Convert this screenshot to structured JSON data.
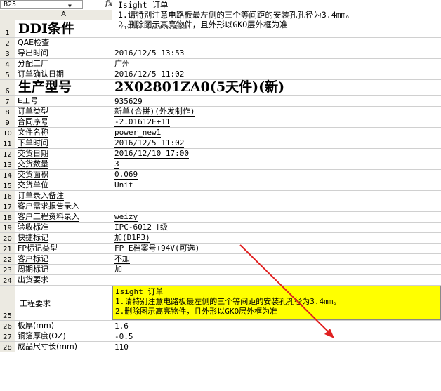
{
  "formula_bar": {
    "name_box": "B25",
    "fx_label": "fx",
    "lines": [
      "Isight 订单",
      "1.请特别注意电路板最左侧的三个等间距的安装孔孔径为3.4mm。",
      "2.删除图示高亮物件，且外形以GKO层外框为准"
    ]
  },
  "columns": {
    "a": "A"
  },
  "overflow_text": "（以光之DDI流程）",
  "rows": [
    {
      "num": "1",
      "a": "DDI条件",
      "b": "",
      "style": "big"
    },
    {
      "num": "2",
      "a": "QAE检查",
      "b": ""
    },
    {
      "num": "3",
      "a": "导出时间",
      "b": "2016/12/5 13:53"
    },
    {
      "num": "4",
      "a": "分配工厂",
      "b": "广州"
    },
    {
      "num": "5",
      "a": "订单确认日期",
      "b": "2016/12/5 11:02"
    },
    {
      "num": "6",
      "a": "生产型号",
      "b": "2X02801ZA0(5天件)(新)",
      "style": "big"
    },
    {
      "num": "7",
      "a": "E工号",
      "b": "935629"
    },
    {
      "num": "8",
      "a": "订单类型",
      "b": "新单(合拼)(外发制作)"
    },
    {
      "num": "9",
      "a": "合同序号",
      "b": "-2.01612E+11"
    },
    {
      "num": "10",
      "a": "文件名称",
      "b": "power_new1"
    },
    {
      "num": "11",
      "a": "下单时间",
      "b": "2016/12/5 11:02"
    },
    {
      "num": "12",
      "a": "交货日期",
      "b": "2016/12/10 17:00"
    },
    {
      "num": "13",
      "a": "交货数量",
      "b": "3"
    },
    {
      "num": "14",
      "a": "交货面积",
      "b": "0.069"
    },
    {
      "num": "15",
      "a": "交货单位",
      "b": "Unit"
    },
    {
      "num": "16",
      "a": "订单录入备注",
      "b": ""
    },
    {
      "num": "17",
      "a": "客户需求报告录入",
      "b": ""
    },
    {
      "num": "18",
      "a": "客户工程资料录入",
      "b": "weizy"
    },
    {
      "num": "19",
      "a": "验收标准",
      "b": "IPC-6012 Ⅱ级"
    },
    {
      "num": "20",
      "a": "快捷标记",
      "b": "加(D1P3)"
    },
    {
      "num": "21",
      "a": "FP标记类型",
      "b": "FP+E档案号+94V(可选)"
    },
    {
      "num": "22",
      "a": "客户标记",
      "b": "不加"
    },
    {
      "num": "23",
      "a": "周期标记",
      "b": "加"
    },
    {
      "num": "24",
      "a": "出货要求",
      "b": ""
    },
    {
      "num": "25",
      "a": "工程要求",
      "b_lines": [
        "Isight 订单",
        "1.请特别注意电路板最左侧的三个等间距的安装孔孔径为3.4mm。",
        "2.删除图示高亮物件，且外形以GKO层外框为准"
      ],
      "style": "yellow"
    },
    {
      "num": "26",
      "a": "板厚(mm)",
      "b": "1.6"
    },
    {
      "num": "27",
      "a": "铜箔厚度(OZ)",
      "b": "-0.5"
    },
    {
      "num": "28",
      "a": "成品尺寸长(mm)",
      "b": "110"
    }
  ],
  "colors": {
    "highlight": "#ffff00",
    "arrow": "#e02020",
    "header_bg": "#eceae2"
  }
}
